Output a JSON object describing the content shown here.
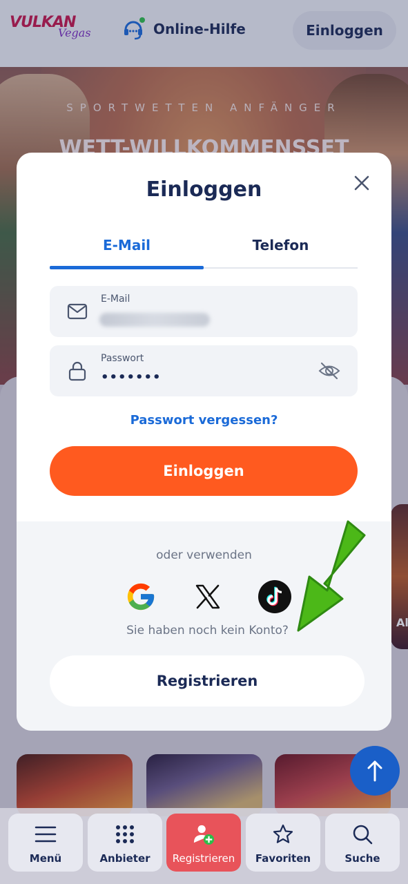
{
  "header": {
    "logo_main": "VULKAN",
    "logo_sub": "Vegas",
    "help_label": "Online-Hilfe",
    "login_label": "Einloggen"
  },
  "banner": {
    "subtitle": "SPORTWETTEN ANFÄNGER",
    "title": "WETT-WILLKOMMENSSET"
  },
  "side_thumb_text": "Al",
  "modal": {
    "title": "Einloggen",
    "tabs": [
      {
        "label": "E-Mail",
        "active": true
      },
      {
        "label": "Telefon",
        "active": false
      }
    ],
    "email_field": {
      "label": "E-Mail"
    },
    "password_field": {
      "label": "Passwort",
      "value": "•••••••"
    },
    "forgot_link": "Passwort vergessen?",
    "login_button": "Einloggen",
    "or_use": "oder verwenden",
    "social": [
      "google-icon",
      "x-icon",
      "tiktok-icon"
    ],
    "no_account": "Sie haben noch kein Konto?",
    "register_button": "Registrieren"
  },
  "bottom_nav": [
    {
      "label": "Menü",
      "icon": "menu-icon"
    },
    {
      "label": "Anbieter",
      "icon": "grid-icon"
    },
    {
      "label": "Registrieren",
      "icon": "add-user-icon",
      "active": true
    },
    {
      "label": "Favoriten",
      "icon": "star-icon"
    },
    {
      "label": "Suche",
      "icon": "search-icon"
    }
  ],
  "colors": {
    "accent_blue": "#1a6ad8",
    "login_orange": "#ff5a1f",
    "navy_text": "#1b2a56",
    "arrow_green": "#4cb818"
  }
}
